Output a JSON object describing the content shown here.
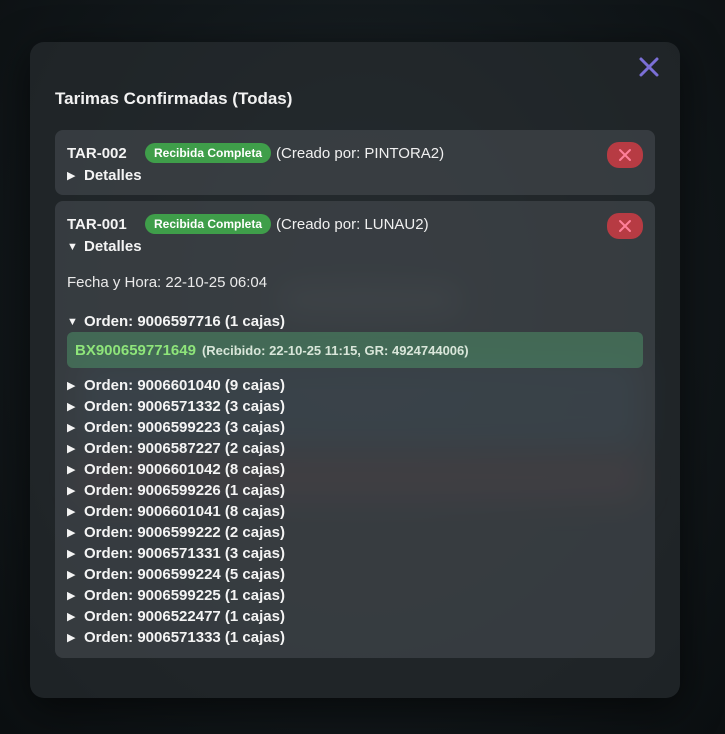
{
  "modal": {
    "title": "Tarimas Confirmadas (Todas)",
    "close_icon": "close-x-icon",
    "accent_color": "#7b6fd6"
  },
  "pallets": [
    {
      "id": "TAR-002",
      "status": "Recibida Completa",
      "creator": "(Creado por: PINTORA2)",
      "details_label": "Detalles",
      "expanded": false
    },
    {
      "id": "TAR-001",
      "status": "Recibida Completa",
      "creator": "(Creado por: LUNAU2)",
      "details_label": "Detalles",
      "expanded": true,
      "datetime": "Fecha y Hora: 22-10-25 06:04",
      "orders": [
        {
          "label": "Orden: 9006597716 (1 cajas)",
          "expanded": true,
          "boxes": [
            {
              "code": "BX900659771649",
              "meta": "(Recibido: 22-10-25 11:15, GR: 4924744006)"
            }
          ]
        },
        {
          "label": "Orden: 9006601040 (9 cajas)"
        },
        {
          "label": "Orden: 9006571332 (3 cajas)"
        },
        {
          "label": "Orden: 9006599223 (3 cajas)"
        },
        {
          "label": "Orden: 9006587227 (2 cajas)"
        },
        {
          "label": "Orden: 9006601042 (8 cajas)"
        },
        {
          "label": "Orden: 9006599226 (1 cajas)"
        },
        {
          "label": "Orden: 9006601041 (8 cajas)"
        },
        {
          "label": "Orden: 9006599222 (2 cajas)"
        },
        {
          "label": "Orden: 9006571331 (3 cajas)"
        },
        {
          "label": "Orden: 9006599224 (5 cajas)"
        },
        {
          "label": "Orden: 9006599225 (1 cajas)"
        },
        {
          "label": "Orden: 9006522477 (1 cajas)"
        },
        {
          "label": "Orden: 9006571333 (1 cajas)"
        }
      ]
    }
  ],
  "colors": {
    "badge": "#3f9e4a",
    "delete": "#b73b43",
    "box_code": "#8ee57a"
  }
}
